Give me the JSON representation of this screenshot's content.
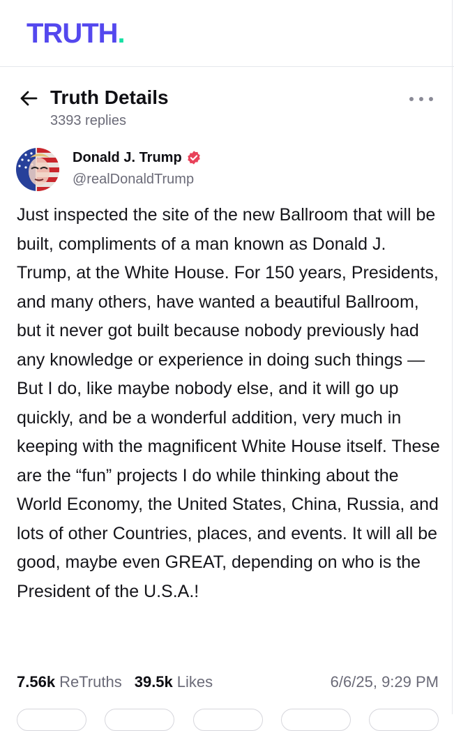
{
  "brand": {
    "word": "TRUTH",
    "dot": "."
  },
  "header": {
    "title": "Truth Details",
    "replies": "3393 replies"
  },
  "author": {
    "name": "Donald J. Trump",
    "handle": "@realDonaldTrump"
  },
  "post": {
    "text": "Just inspected the site of the new Ballroom that will be built, compliments of a man known as Donald J. Trump, at the White House. For 150 years, Presidents, and many others, have wanted a beautiful Ballroom, but it never got built because nobody previously had any knowledge or experience in doing such things — But I do, like maybe nobody else, and it will go up quickly, and be a wonderful addition, very much in keeping with the magnificent White House itself. These are the “fun” projects I do while thinking about the World Economy, the United States, China, Russia, and lots of other Countries, places, and events. It will all be good, maybe even GREAT, depending on who is the President of the U.S.A.!"
  },
  "stats": {
    "retruths_count": "7.56k",
    "retruths_label": "ReTruths",
    "likes_count": "39.5k",
    "likes_label": "Likes",
    "timestamp": "6/6/25, 9:29 PM"
  },
  "icons": {
    "back": "arrow-left-icon",
    "more": "more-horizontal-icon",
    "verified": "verified-badge-icon"
  },
  "colors": {
    "brand": "#5448ee",
    "brand_dot": "#17e0a4",
    "verified": "#e8425a",
    "muted": "#6b6b78"
  }
}
